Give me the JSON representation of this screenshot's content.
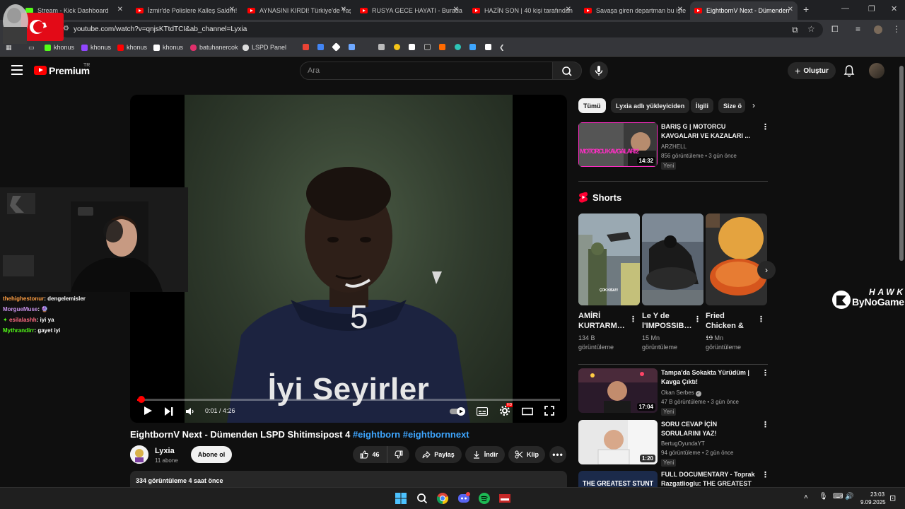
{
  "browser": {
    "tabs": [
      {
        "title": "Stream - Kick Dashboard",
        "favicon": "kick-icon"
      },
      {
        "title": "İzmir'de Polislere Kalleş Saldırı!",
        "favicon": "youtube-icon"
      },
      {
        "title": "AYNASINI KIRDI! Türkiye'de Yaş",
        "favicon": "youtube-icon"
      },
      {
        "title": "RUSYA GECE HAYATI - Burada İ",
        "favicon": "youtube-icon"
      },
      {
        "title": "HAZİN SON | 40 kişi tarafından",
        "favicon": "youtube-icon"
      },
      {
        "title": "Savaşa giren departman bu işte",
        "favicon": "youtube-icon"
      },
      {
        "title": "EightbornV Next - Dümenden",
        "favicon": "youtube-icon"
      }
    ],
    "url": "youtube.com/watch?v=qnjsKTtdTCI&ab_channel=Lyxia",
    "bookmarks": [
      {
        "label": "khonus",
        "color": "#53fc18"
      },
      {
        "label": "khonus",
        "color": "#9146ff"
      },
      {
        "label": "khonus",
        "color": "#ff0000"
      },
      {
        "label": "khonus",
        "color": "#ffffff"
      },
      {
        "label": "batuhanercok",
        "color": "#e1306c"
      },
      {
        "label": "LSPD Panel",
        "color": "#dddddd"
      }
    ]
  },
  "youtube": {
    "logo_text": "Premium",
    "country": "TR",
    "search_placeholder": "Ara",
    "create_label": "Oluştur"
  },
  "player": {
    "overlay_text": "İyi Seyirler",
    "time_display": "0:01 / 4:26",
    "progress": 0.004,
    "jersey_number": "5"
  },
  "video": {
    "title_main": "EightbornV Next - Dümenden LSPD Shitimsipost 4",
    "hashtag1": "#eightborn",
    "hashtag2": "#eightbornnext",
    "channel": "Lyxia",
    "subscribers": "11 abone",
    "subscribe_label": "Abone ol",
    "likes": "46",
    "share_label": "Paylaş",
    "download_label": "İndir",
    "clip_label": "Klip",
    "views_line": "334 görüntüleme  4 saat önce"
  },
  "chat": [
    {
      "user": "thehighestonur",
      "msg": ": dengelemisler",
      "color": "#ff9f43"
    },
    {
      "user": "MorgueMuse",
      "msg": ": 🔮",
      "color": "#c792ea"
    },
    {
      "user": "esilalashh",
      "msg": ": iyi ya",
      "color": "#ff6b81"
    },
    {
      "user": "Mythrandirr",
      "msg": ": gayet iyi",
      "color": "#53fc18"
    }
  ],
  "sidebar": {
    "chips": [
      "Tümü",
      "Lyxia adlı yükleyiciden",
      "İlgili",
      "Size ö"
    ],
    "recommendations": [
      {
        "title": "BARIŞ G | MOTORCU KAVGALARI VE KAZALARI ...",
        "channel": "ARZHELL",
        "meta": "856 görüntüleme • 3 gün önce",
        "badge": "Yeni",
        "duration": "14:32",
        "thumb_text": "MOTORCU KAVGALARI 2"
      },
      {
        "title": "Tampa'da Sokakta Yürüdüm | Kavga Çıktı!",
        "channel": "Okan Serbes",
        "meta": "47 B görüntüleme • 3 gün önce",
        "badge": "Yeni",
        "duration": "17:04"
      },
      {
        "title": "SORU CEVAP İÇİN SORULARINI YAZ!",
        "channel": "BertugOyundaYT",
        "meta": "94 görüntüleme • 2 gün önce",
        "badge": "Yeni",
        "duration": "1:20"
      },
      {
        "title": "FULL DOCUMENTARY - Toprak Razgatlioglu: THE GREATEST ...",
        "thumb_text": "THE GREATEST STUNT"
      }
    ],
    "shorts_title": "Shorts",
    "shorts": [
      {
        "title": "AMİRİ KURTARM…",
        "views": "134 B görüntüleme",
        "thumb_text": "ÇOK KISA!!!"
      },
      {
        "title": "Le Y de l'IMPOSSIB…",
        "views": "15 Mn görüntüleme"
      },
      {
        "title": "Fried Chicken & …",
        "views": "13 Mn görüntüleme"
      }
    ]
  },
  "watermark": {
    "brand": "ByNoGame",
    "top": "HAWK"
  },
  "taskbar": {
    "time": "23:03",
    "date": "9.09.2025"
  }
}
